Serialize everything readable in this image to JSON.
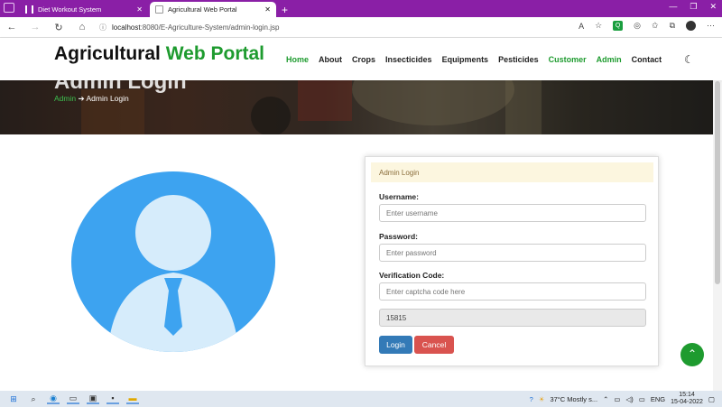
{
  "browser": {
    "tabs": [
      {
        "title": "Diet Workout System",
        "active": false
      },
      {
        "title": "Agricultural Web Portal",
        "active": true
      }
    ],
    "url_host": "localhost",
    "url_path": ":8080/E-Agriculture-System/admin-login.jsp"
  },
  "site": {
    "brand_part1": "Agricultural",
    "brand_part2": "Web Portal",
    "nav": [
      "Home",
      "About",
      "Crops",
      "Insecticides",
      "Equipments",
      "Pesticides",
      "Customer",
      "Admin",
      "Contact"
    ],
    "nav_highlighted": [
      "Home",
      "Customer",
      "Admin"
    ]
  },
  "hero": {
    "title": "Admin Login",
    "breadcrumb_link": "Admin",
    "breadcrumb_current": "Admin Login"
  },
  "login": {
    "header": "Admin Login",
    "username_label": "Username:",
    "username_placeholder": "Enter username",
    "password_label": "Password:",
    "password_placeholder": "Enter password",
    "captcha_label": "Verification Code:",
    "captcha_placeholder": "Enter captcha code here",
    "captcha_code": "15815",
    "login_button": "Login",
    "cancel_button": "Cancel"
  },
  "taskbar": {
    "weather": "37°C  Mostly s...",
    "lang": "ENG",
    "time": "15:14",
    "date": "15-04-2022"
  },
  "colors": {
    "brand_green": "#1e9b2f",
    "tab_purple": "#8a1fa6",
    "login_blue": "#337ab7",
    "cancel_red": "#d9534f",
    "avatar_blue": "#3da3f0"
  }
}
